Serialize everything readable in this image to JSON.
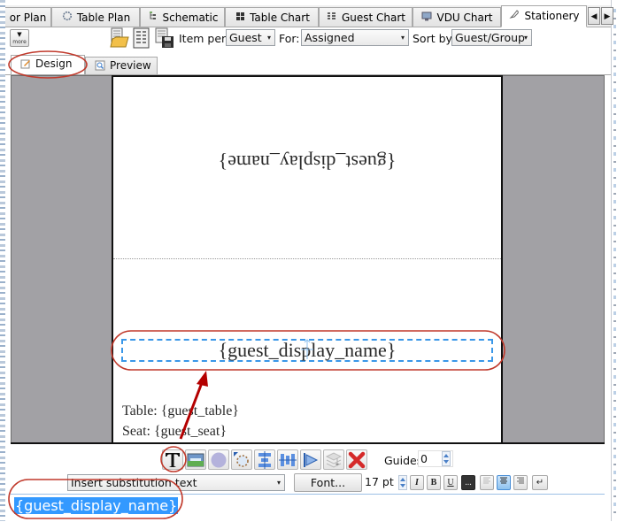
{
  "top_tabs": [
    {
      "label": "or Plan",
      "icon": "floor-plan-icon"
    },
    {
      "label": "Table Plan",
      "icon": "circle-table-icon"
    },
    {
      "label": "Schematic",
      "icon": "schematic-icon"
    },
    {
      "label": "Table Chart",
      "icon": "table-chart-icon"
    },
    {
      "label": "Guest Chart",
      "icon": "guest-chart-icon"
    },
    {
      "label": "VDU Chart",
      "icon": "monitor-icon"
    },
    {
      "label": "Stationery",
      "icon": "stationery-icon",
      "active": true
    }
  ],
  "tab_scroll": {
    "left": "◀",
    "right": "▶"
  },
  "toolbar": {
    "more_label": "more",
    "more_arrow": "▼",
    "item_per_label": "Item per:",
    "item_per_value": "Guest",
    "for_label": "For:",
    "for_value": "Assigned",
    "sort_by_label": "Sort by:",
    "sort_by_value": "Guest/Group",
    "dropdown_glyph": "▾"
  },
  "view_tabs": [
    {
      "label": "Design",
      "active": true
    },
    {
      "label": "Preview",
      "active": false
    }
  ],
  "card": {
    "upside_down_text": "{guest_display_name}",
    "front_name_text": "{guest_display_name}",
    "table_line": "Table: {guest_table}",
    "seat_line": "Seat: {guest_seat}"
  },
  "object_toolbar": {
    "tools": [
      "text-tool",
      "image-tool",
      "ellipse-tool",
      "shape-tool",
      "align-vertical-tool",
      "distribute-horizontal-tool",
      "flip-tool",
      "layer-tool",
      "delete-tool"
    ],
    "guides_label": "Guides:",
    "guides_value": "0"
  },
  "format_bar": {
    "substitution_placeholder": "Insert substitution text",
    "font_button": "Font...",
    "size_value": "17 pt",
    "italic": "I",
    "bold": "B",
    "underline": "U",
    "color_button": "...",
    "align": [
      "left",
      "center",
      "right"
    ],
    "align_selected": "center",
    "newline_glyph": "↵"
  },
  "editor": {
    "selected_text": "{guest_display_name}"
  },
  "colors": {
    "annotation_red": "#c0392b",
    "arrow_red": "#b40000",
    "selection_blue": "#3399ff",
    "guide_dash_blue": "#3a97e8",
    "canvas_gray": "#a2a1a5"
  }
}
